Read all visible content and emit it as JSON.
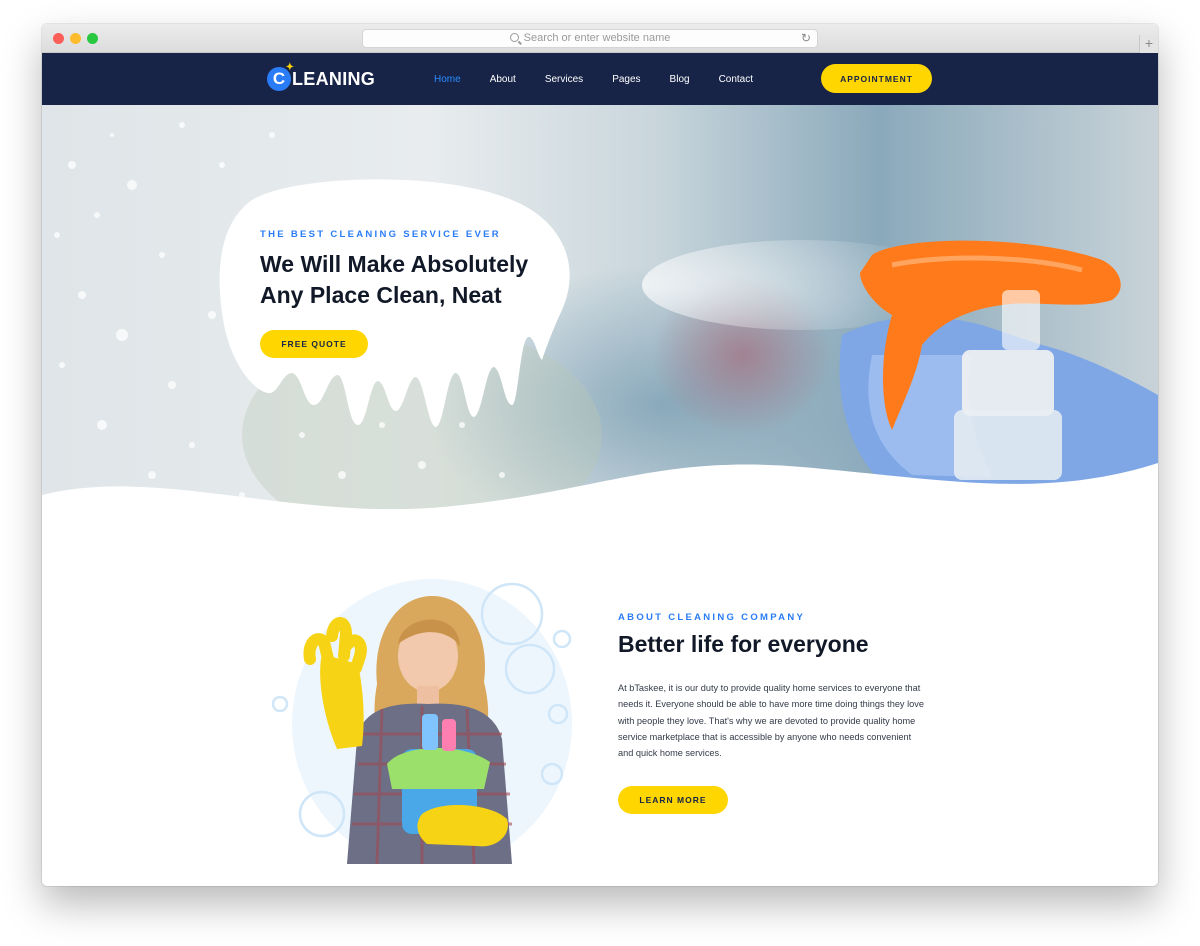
{
  "browser": {
    "url_placeholder": "Search or enter website name",
    "reload_icon": "reload-icon",
    "new_tab_label": "+"
  },
  "brand": {
    "logo_letter": "C",
    "logo_text": "LEANING",
    "accent_blue": "#2a7cf6",
    "accent_yellow": "#ffd600",
    "navy": "#172447"
  },
  "nav": {
    "items": [
      {
        "label": "Home",
        "active": true
      },
      {
        "label": "About",
        "active": false
      },
      {
        "label": "Services",
        "active": false
      },
      {
        "label": "Pages",
        "active": false
      },
      {
        "label": "Blog",
        "active": false
      },
      {
        "label": "Contact",
        "active": false
      }
    ],
    "cta_label": "APPOINTMENT"
  },
  "hero": {
    "eyebrow": "THE BEST CLEANING SERVICE EVER",
    "title": "We Will Make Absolutely Any Place Clean, Neat",
    "cta_label": "FREE QUOTE"
  },
  "about": {
    "eyebrow": "ABOUT CLEANING COMPANY",
    "title": "Better life for everyone",
    "body": "At bTaskee, it is our duty to provide quality home services to everyone that needs it. Everyone should be able to have more time doing things they love with people they love. That's why we are devoted to provide quality home service marketplace that is accessible by anyone who needs convenient and quick home services.",
    "cta_label": "LEARN MORE"
  }
}
